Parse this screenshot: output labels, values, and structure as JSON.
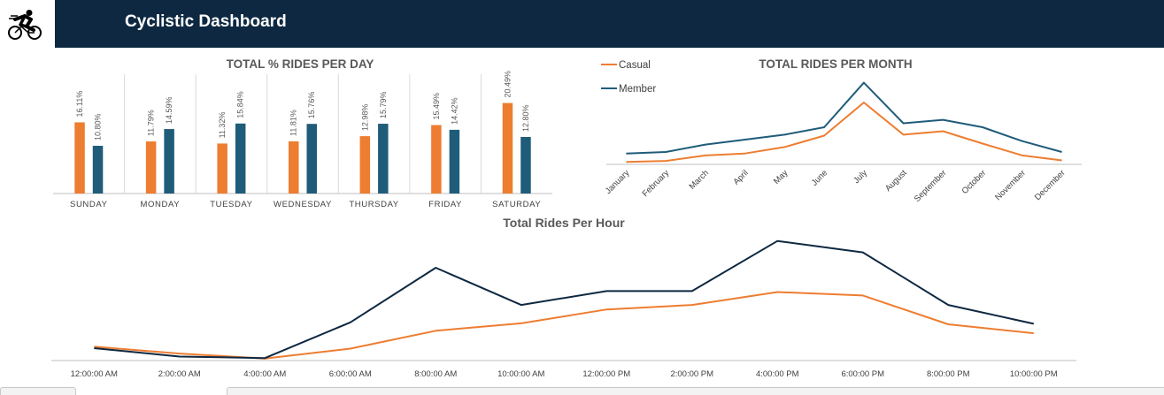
{
  "app": {
    "title": "Cyclistic Dashboard",
    "logo_icon": "cyclist-icon"
  },
  "colors": {
    "casual": "#ed7d31",
    "member": "#1f5c7a",
    "member_hourly": "#0e2841",
    "header_bg": "#0e2841"
  },
  "chart_data": [
    {
      "type": "bar",
      "title": "TOTAL % RIDES PER DAY",
      "categories": [
        "SUNDAY",
        "MONDAY",
        "TUESDAY",
        "WEDNESDAY",
        "THURSDAY",
        "FRIDAY",
        "SATURDAY"
      ],
      "series": [
        {
          "color": "#ed7d31",
          "values": [
            16.11,
            11.79,
            11.32,
            11.81,
            12.98,
            15.49,
            20.49
          ],
          "labels": [
            "16.11%",
            "11.79%",
            "11.32%",
            "11.81%",
            "12.98%",
            "15.49%",
            "20.49%"
          ]
        },
        {
          "color": "#1f5c7a",
          "values": [
            10.8,
            14.59,
            15.84,
            15.76,
            15.79,
            14.42,
            12.8
          ],
          "labels": [
            "10.80%",
            "14.59%",
            "15.84%",
            "15.76%",
            "15.79%",
            "14.42%",
            "12.80%"
          ]
        }
      ],
      "ylim": [
        0,
        25
      ],
      "grid": false,
      "legend": "none"
    },
    {
      "type": "line",
      "title": "TOTAL RIDES PER MONTH",
      "categories": [
        "January",
        "February",
        "March",
        "April",
        "May",
        "June",
        "July",
        "August",
        "September",
        "October",
        "November",
        "December"
      ],
      "series": [
        {
          "name": "Casual",
          "color": "#ed7d31",
          "values": [
            5,
            7,
            18,
            22,
            35,
            58,
            125,
            60,
            67,
            42,
            18,
            8
          ]
        },
        {
          "name": "Member",
          "color": "#1f5c7a",
          "values": [
            22,
            25,
            40,
            50,
            60,
            75,
            165,
            83,
            90,
            75,
            47,
            25
          ]
        }
      ],
      "ylim": [
        0,
        175
      ],
      "grid": false,
      "legend": "top-left"
    },
    {
      "type": "line",
      "title": "Total Rides Per Hour",
      "categories": [
        "12:00:00 AM",
        "2:00:00 AM",
        "4:00:00 AM",
        "6:00:00 AM",
        "8:00:00 AM",
        "10:00:00 AM",
        "12:00:00 PM",
        "2:00:00 PM",
        "4:00:00 PM",
        "6:00:00 PM",
        "8:00:00 PM",
        "10:00:00 PM"
      ],
      "series": [
        {
          "color": "#ed7d31",
          "values": [
            28,
            14,
            4,
            24,
            60,
            75,
            103,
            112,
            138,
            131,
            73,
            55
          ]
        },
        {
          "color": "#0e2841",
          "values": [
            25,
            8,
            5,
            77,
            187,
            112,
            140,
            140,
            241,
            218,
            112,
            74
          ]
        }
      ],
      "ylim": [
        0,
        260
      ],
      "grid": false,
      "legend": "none"
    }
  ]
}
